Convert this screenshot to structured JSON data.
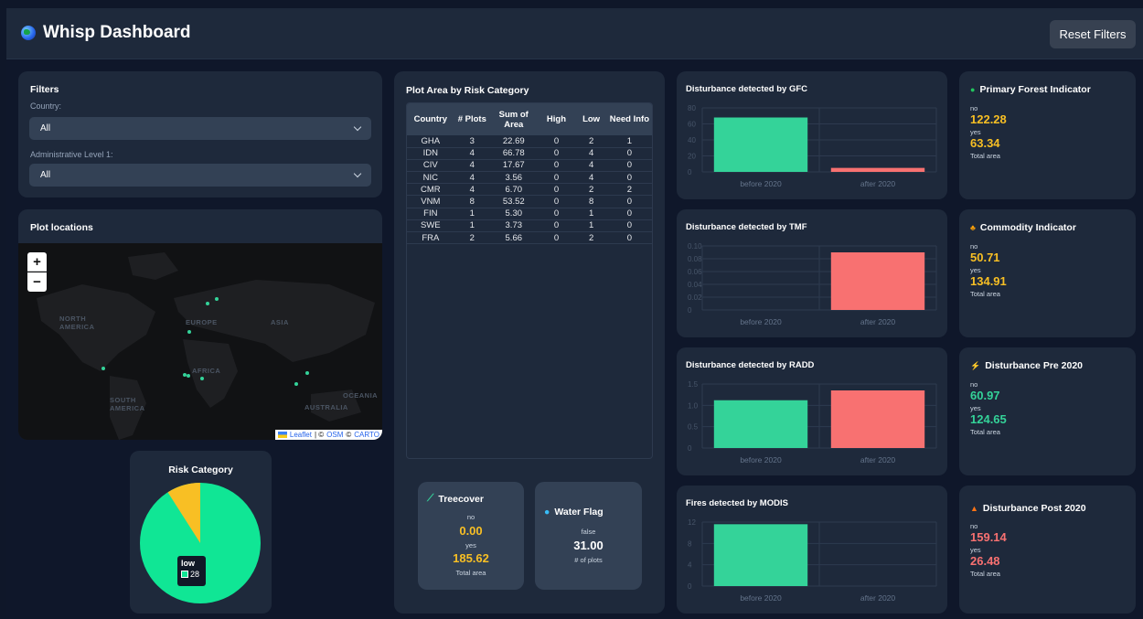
{
  "header": {
    "title": "Whisp Dashboard",
    "reset_label": "Reset Filters"
  },
  "filters": {
    "title": "Filters",
    "country_label": "Country:",
    "country_value": "All",
    "admin_label": "Administrative Level 1:",
    "admin_value": "All"
  },
  "map": {
    "title": "Plot locations",
    "zoom_in": "+",
    "zoom_out": "−",
    "labels": [
      "NORTH AMERICA",
      "EUROPE",
      "ASIA",
      "AFRICA",
      "SOUTH AMERICA",
      "AUSTRALIA",
      "OCEANIA"
    ],
    "attribution": {
      "leaflet": "Leaflet",
      "sep": " | © ",
      "osm": "OSM",
      "carto": "CARTO"
    }
  },
  "risk": {
    "title": "Risk Category",
    "tooltip_label": "low",
    "tooltip_value": "28",
    "colors": {
      "low": "#10e695",
      "other": "#f8bf24"
    }
  },
  "table": {
    "title": "Plot Area by Risk Category",
    "headers": [
      "Country",
      "# Plots",
      "Sum of Area",
      "High",
      "Low",
      "Need Info"
    ],
    "rows": [
      [
        "GHA",
        "3",
        "22.69",
        "0",
        "2",
        "1"
      ],
      [
        "IDN",
        "4",
        "66.78",
        "0",
        "4",
        "0"
      ],
      [
        "CIV",
        "4",
        "17.67",
        "0",
        "4",
        "0"
      ],
      [
        "NIC",
        "4",
        "3.56",
        "0",
        "4",
        "0"
      ],
      [
        "CMR",
        "4",
        "6.70",
        "0",
        "2",
        "2"
      ],
      [
        "VNM",
        "8",
        "53.52",
        "0",
        "8",
        "0"
      ],
      [
        "FIN",
        "1",
        "5.30",
        "0",
        "1",
        "0"
      ],
      [
        "SWE",
        "1",
        "3.73",
        "0",
        "1",
        "0"
      ],
      [
        "FRA",
        "2",
        "5.66",
        "0",
        "2",
        "0"
      ]
    ]
  },
  "treecover": {
    "title": "Treecover",
    "no_label": "no",
    "no_value": "0.00",
    "yes_label": "yes",
    "yes_value": "185.62",
    "footer": "Total area"
  },
  "waterflag": {
    "title": "Water Flag",
    "false_label": "false",
    "value": "31.00",
    "footer": "# of plots"
  },
  "chart_data": [
    {
      "type": "bar",
      "title": "Disturbance detected by GFC",
      "categories": [
        "before 2020",
        "after 2020"
      ],
      "values": [
        68,
        5
      ],
      "colors": [
        "#34d399",
        "#f87171"
      ],
      "ylim": [
        0,
        80
      ],
      "yticks": [
        "80",
        "60",
        "40",
        "20",
        "0"
      ]
    },
    {
      "type": "bar",
      "title": "Disturbance detected by TMF",
      "categories": [
        "before 2020",
        "after 2020"
      ],
      "values": [
        0,
        0.09
      ],
      "colors": [
        "#34d399",
        "#f87171"
      ],
      "ylim": [
        0,
        0.1
      ],
      "yticks": [
        "0.10",
        "0.08",
        "0.06",
        "0.04",
        "0.02",
        "0"
      ]
    },
    {
      "type": "bar",
      "title": "Disturbance detected by RADD",
      "categories": [
        "before 2020",
        "after 2020"
      ],
      "values": [
        1.12,
        1.35
      ],
      "colors": [
        "#34d399",
        "#f87171"
      ],
      "ylim": [
        0,
        1.5
      ],
      "yticks": [
        "1.5",
        "1.0",
        "0.5",
        "0"
      ]
    },
    {
      "type": "bar",
      "title": "Fires detected by MODIS",
      "categories": [
        "before 2020",
        "after 2020"
      ],
      "values": [
        11.6,
        0
      ],
      "colors": [
        "#34d399",
        "#f87171"
      ],
      "ylim": [
        0,
        12
      ],
      "yticks": [
        "12",
        "8",
        "4",
        "0"
      ]
    }
  ],
  "indicators": [
    {
      "title": "Primary Forest Indicator",
      "no_label": "no",
      "no_value": "122.28",
      "yes_label": "yes",
      "yes_value": "63.34",
      "footer": "Total area",
      "color": "#f8bf24"
    },
    {
      "title": "Commodity Indicator",
      "no_label": "no",
      "no_value": "50.71",
      "yes_label": "yes",
      "yes_value": "134.91",
      "footer": "Total area",
      "color": "#f8bf24"
    },
    {
      "title": "Disturbance Pre 2020",
      "no_label": "no",
      "no_value": "60.97",
      "yes_label": "yes",
      "yes_value": "124.65",
      "footer": "Total area",
      "color": "#34d399"
    },
    {
      "title": "Disturbance Post 2020",
      "no_label": "no",
      "no_value": "159.14",
      "yes_label": "yes",
      "yes_value": "26.48",
      "footer": "Total area",
      "color": "#f87171"
    }
  ]
}
